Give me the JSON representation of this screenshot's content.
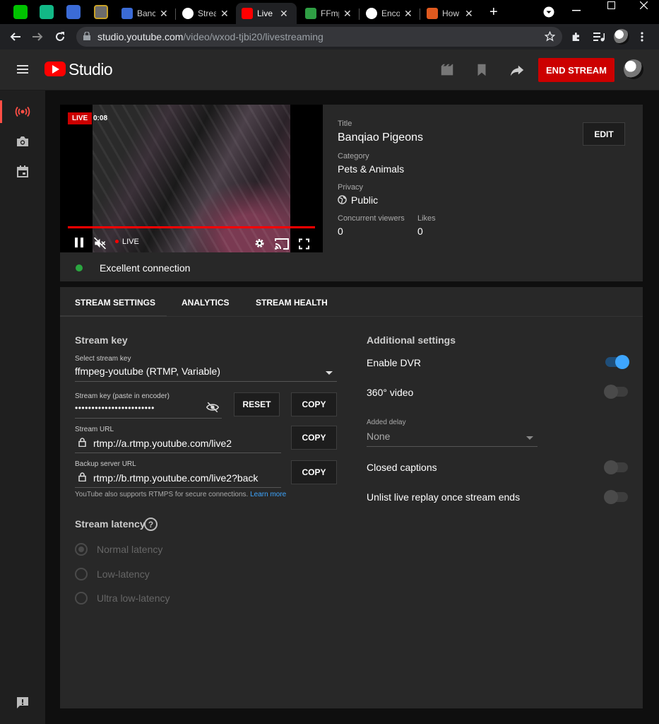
{
  "browser": {
    "tabs": [
      {
        "label": "Banc",
        "color": "#3b6bd6"
      },
      {
        "label": "Strea",
        "color": "#ffffff"
      },
      {
        "label": "Live",
        "color": "#ff0000"
      },
      {
        "label": "FFmp",
        "color": "#2f9e44"
      },
      {
        "label": "Enco",
        "color": "#ffffff"
      },
      {
        "label": "How",
        "color": "#e05a1f"
      }
    ],
    "close_glyph": "✕",
    "new_tab_glyph": "+",
    "url_host": "studio.youtube.com",
    "url_path": "/video/wxod-tjbi20/livestreaming"
  },
  "header": {
    "app_name": "Studio",
    "end_stream_label": "END STREAM"
  },
  "player": {
    "live_badge": "LIVE",
    "elapsed": "0:08",
    "live_label": "LIVE",
    "progress_fraction": 1.0
  },
  "details": {
    "title_label": "Title",
    "title": "Banqiao Pigeons",
    "category_label": "Category",
    "category": "Pets & Animals",
    "privacy_label": "Privacy",
    "privacy": "Public",
    "viewers_label": "Concurrent viewers",
    "viewers": "0",
    "likes_label": "Likes",
    "likes": "0",
    "edit_label": "EDIT"
  },
  "connection": {
    "status": "Excellent connection",
    "status_color": "#2ba640"
  },
  "tabs": {
    "items": [
      "STREAM SETTINGS",
      "ANALYTICS",
      "STREAM HEALTH"
    ]
  },
  "stream_key": {
    "heading": "Stream key",
    "select_label": "Select stream key",
    "select_value": "ffmpeg-youtube (RTMP, Variable)",
    "key_label": "Stream key (paste in encoder)",
    "key_value": "••••••••••••••••••••••••",
    "reset_label": "RESET",
    "copy_label": "COPY",
    "url_label": "Stream URL",
    "url_value": "rtmp://a.rtmp.youtube.com/live2",
    "backup_label": "Backup server URL",
    "backup_value": "rtmp://b.rtmp.youtube.com/live2?back",
    "note": "YouTube also supports RTMPS for secure connections.",
    "learn_more": "Learn more"
  },
  "latency": {
    "heading": "Stream latency",
    "help_glyph": "?",
    "options": [
      "Normal latency",
      "Low-latency",
      "Ultra low-latency"
    ],
    "selected": "Normal latency"
  },
  "additional": {
    "heading": "Additional settings",
    "enable_dvr": "Enable DVR",
    "enable_dvr_on": true,
    "video_360": "360° video",
    "video_360_on": false,
    "delay_label": "Added delay",
    "delay_value": "None",
    "closed_captions": "Closed captions",
    "closed_captions_on": false,
    "unlist_replay": "Unlist live replay once stream ends",
    "unlist_replay_on": false
  },
  "colors": {
    "accent_red": "#cc0000",
    "accent_blue": "#3ea6ff",
    "panel": "#282828"
  }
}
